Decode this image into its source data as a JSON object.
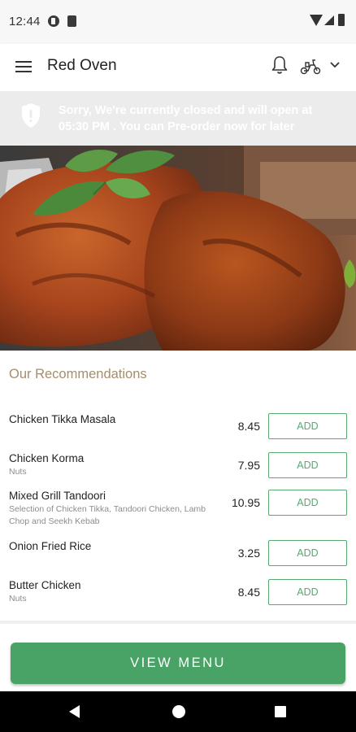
{
  "status_bar": {
    "time": "12:44",
    "icons": [
      "notification-app-icon",
      "sim-card-icon",
      "wifi-icon",
      "signal-icon",
      "battery-icon"
    ]
  },
  "app_bar": {
    "title": "Red Oven",
    "icons": [
      "menu-icon",
      "bell-icon",
      "scooter-icon",
      "chevron-down-icon"
    ]
  },
  "banner": {
    "icon": "shield-icon",
    "text": "Sorry, We're currently closed and will open at 05:30 PM . You can Pre-order now for later"
  },
  "hero": {
    "image": "grilled-chicken-with-mint"
  },
  "recommendations": {
    "title": "Our Recommendations",
    "add_label": "ADD",
    "items": [
      {
        "name": "Chicken Tikka Masala",
        "desc": "",
        "price": "8.45"
      },
      {
        "name": "Chicken Korma",
        "desc": "Nuts",
        "price": "7.95"
      },
      {
        "name": "Mixed Grill Tandoori",
        "desc": "Selection of Chicken Tikka, Tandoori Chicken, Lamb Chop and Seekh Kebab",
        "price": "10.95"
      },
      {
        "name": "Onion Fried Rice",
        "desc": "",
        "price": "3.25"
      },
      {
        "name": "Butter Chicken",
        "desc": "Nuts",
        "price": "8.45"
      }
    ]
  },
  "view_menu_label": "VIEW MENU",
  "colors": {
    "accent_green": "#4aa366",
    "add_green": "#5aa872",
    "section_title": "#a48e6d",
    "banner_bg": "#ececec"
  },
  "nav_bar": {
    "icons": [
      "back-icon",
      "home-icon",
      "recents-icon"
    ]
  }
}
